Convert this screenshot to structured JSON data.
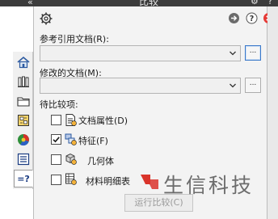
{
  "window": {
    "title": "比较",
    "collapse_glyph": "«",
    "right_glyphs": "⚙ ?",
    "title_icons": [
      "collapse-chevron-icon",
      "gear-icon",
      "help-icon"
    ]
  },
  "header": {
    "icons": [
      "gear-icon",
      "arrow-circle-icon",
      "help-circle-icon",
      "close-circle-icon"
    ],
    "help_glyph": "?"
  },
  "reference_doc": {
    "label": "参考引用文档(R):",
    "value": "",
    "browse_label": "..."
  },
  "modified_doc": {
    "label": "修改的文档(M):",
    "value": "",
    "browse_label": "..."
  },
  "compare_items": {
    "heading": "待比较项:",
    "items": [
      {
        "label": "文档属性(D)",
        "checked": false,
        "icon": "document-properties-icon"
      },
      {
        "label": "特征(F)",
        "checked": true,
        "icon": "features-icon"
      },
      {
        "label": "几何体",
        "checked": false,
        "icon": "geometry-icon"
      },
      {
        "label": "材料明细表",
        "checked": false,
        "icon": "bill-of-materials-icon"
      }
    ]
  },
  "run_button": {
    "label": "运行比较(C)",
    "enabled": false
  },
  "left_tabs": [
    {
      "icon": "home-icon"
    },
    {
      "icon": "library-books-icon"
    },
    {
      "icon": "folder-icon"
    },
    {
      "icon": "view-palette-icon"
    },
    {
      "icon": "appearance-color-icon"
    },
    {
      "icon": "custom-properties-icon"
    },
    {
      "icon": "compare-icon",
      "text": "=?",
      "active": true
    }
  ],
  "watermark": {
    "text": "生信科技",
    "logo_color": "#d9342b"
  },
  "colors": {
    "focus_border": "#3a78c9",
    "panel_bg": "#f3f3f3",
    "titlebar_bg": "#3c3c3c"
  }
}
